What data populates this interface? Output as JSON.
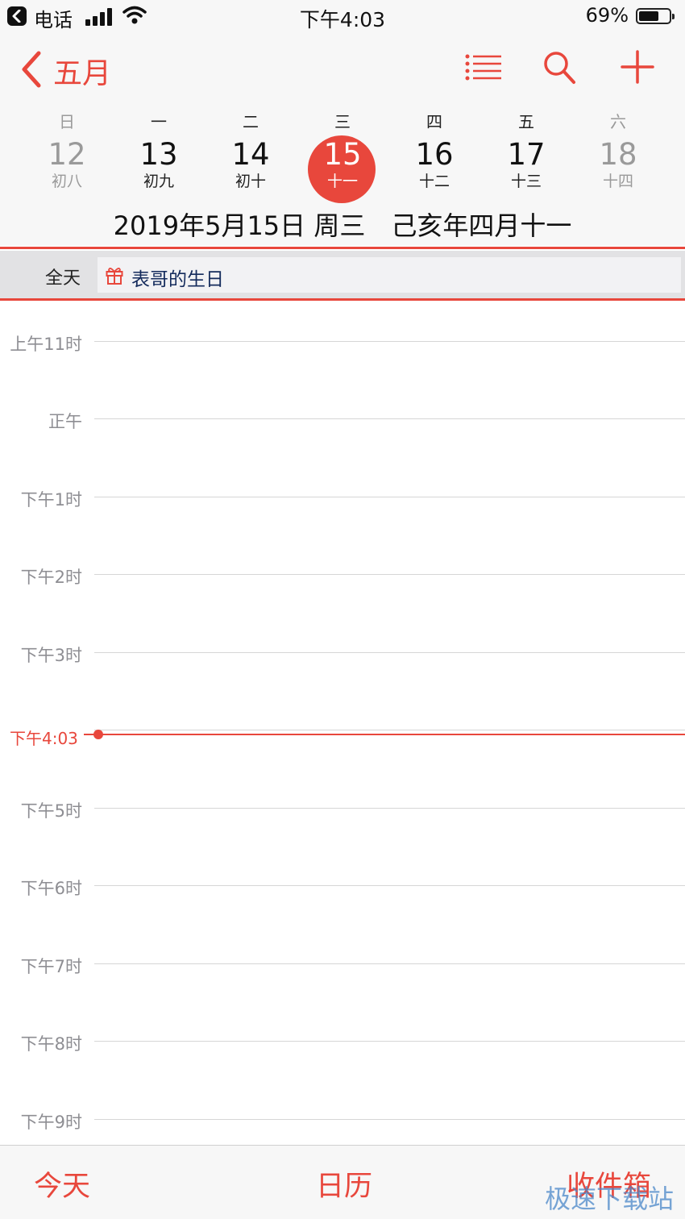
{
  "status_bar": {
    "carrier": "电话",
    "time": "下午4:03",
    "battery": "69%"
  },
  "nav": {
    "month": "五月"
  },
  "week": {
    "weekdays": [
      "日",
      "一",
      "二",
      "三",
      "四",
      "五",
      "六"
    ],
    "days": [
      {
        "num": "12",
        "lunar": "初八"
      },
      {
        "num": "13",
        "lunar": "初九"
      },
      {
        "num": "14",
        "lunar": "初十"
      },
      {
        "num": "15",
        "lunar": "十一"
      },
      {
        "num": "16",
        "lunar": "十二"
      },
      {
        "num": "17",
        "lunar": "十三"
      },
      {
        "num": "18",
        "lunar": "十四"
      }
    ],
    "selected_date": "2019年5月15日 周三　己亥年四月十一"
  },
  "all_day": {
    "label": "全天",
    "event": "表哥的生日"
  },
  "timeline": {
    "hours": [
      "上午11时",
      "正午",
      "下午1时",
      "下午2时",
      "下午3时",
      "下午5时",
      "下午6时",
      "下午7时",
      "下午8时",
      "下午9时"
    ],
    "now": "下午4:03"
  },
  "tab_bar": {
    "today": "今天",
    "calendars": "日历",
    "inbox": "收件箱"
  },
  "watermark": "极速下载站",
  "colors": {
    "accent": "#e8473c",
    "event_text": "#142b5c"
  }
}
